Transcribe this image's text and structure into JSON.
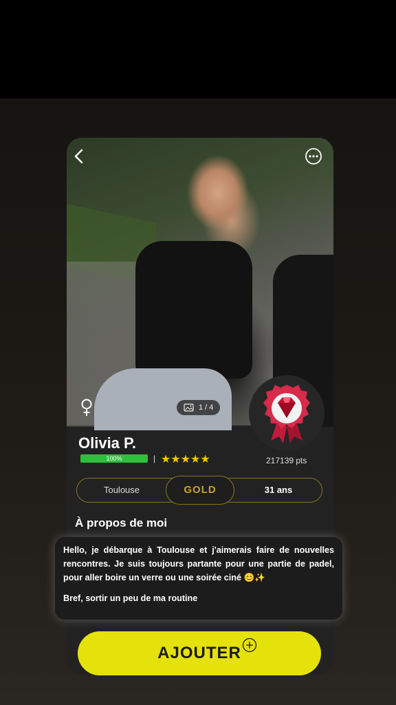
{
  "profile": {
    "name": "Olivia P.",
    "progress_label": "100%",
    "progress_value": 1.0,
    "separator": "|",
    "stars": "★★★★★",
    "rating": 5,
    "points": "217139 pts",
    "photo_counter": "1 / 4",
    "city": "Toulouse",
    "level": "GOLD",
    "age": "31 ans"
  },
  "about": {
    "title": "À propos de moi",
    "bio_line1": "Hello, je débarque à Toulouse et j'aimerais faire de nouvelles rencontres. Je suis toujours partante pour une partie de padel, pour aller boire un verre ou une soirée ciné 😊✨",
    "bio_line2": "Bref, sortir un peu de ma routine"
  },
  "actions": {
    "add_label": "AJOUTER"
  },
  "icons": {
    "back": "back-arrow-icon",
    "more": "more-options-icon",
    "gender": "female-icon",
    "gallery": "gallery-icon",
    "badge": "ruby-medal-icon",
    "plus": "plus-circle-icon"
  },
  "colors": {
    "accent_yellow": "#e5e10b",
    "gold": "#c9a227",
    "progress_green": "#2fbf3c",
    "star": "#f2c500",
    "card_bg": "#222222"
  }
}
